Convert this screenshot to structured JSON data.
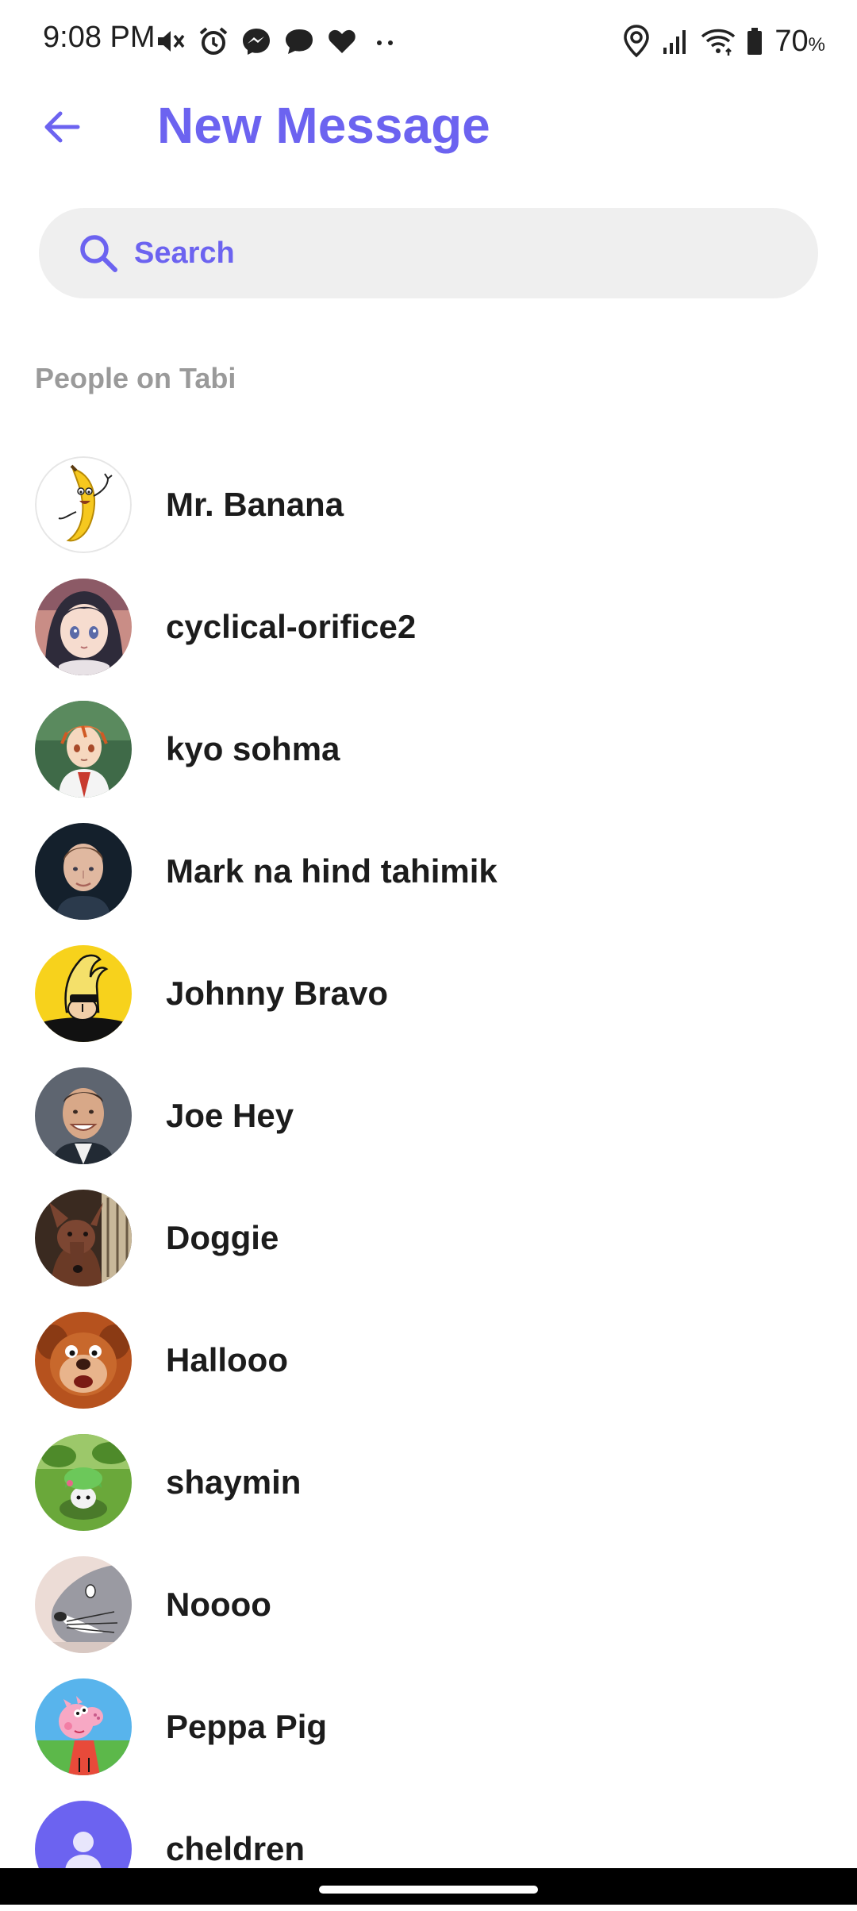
{
  "status_bar": {
    "time": "9:08 PM",
    "battery": "70",
    "battery_unit": "%",
    "icons_left": [
      "mute-icon",
      "alarm-icon",
      "messenger-icon",
      "chat-bubble-icon",
      "heart-icon",
      "more-dots-icon"
    ],
    "icons_right": [
      "location-icon",
      "signal-icon",
      "wifi-icon",
      "battery-icon"
    ]
  },
  "header": {
    "title": "New Message",
    "accent_color": "#6c63f0"
  },
  "search": {
    "placeholder": "Search"
  },
  "section": {
    "label": "People on Tabi"
  },
  "contacts": [
    {
      "name": "Mr. Banana",
      "avatar": "banana-avatar"
    },
    {
      "name": "cyclical-orifice2",
      "avatar": "anime-girl-avatar"
    },
    {
      "name": "kyo sohma",
      "avatar": "anime-boy-avatar"
    },
    {
      "name": "Mark na hind tahimik",
      "avatar": "man-portrait-avatar"
    },
    {
      "name": "Johnny Bravo",
      "avatar": "cartoon-character-avatar"
    },
    {
      "name": "Joe Hey",
      "avatar": "smiling-man-avatar"
    },
    {
      "name": "Doggie",
      "avatar": "dog-avatar"
    },
    {
      "name": "Hallooo",
      "avatar": "cartoon-mouse-avatar"
    },
    {
      "name": "shaymin",
      "avatar": "pokemon-avatar"
    },
    {
      "name": "Noooo",
      "avatar": "cartoon-rabbit-avatar"
    },
    {
      "name": "Peppa Pig",
      "avatar": "cartoon-pig-avatar"
    },
    {
      "name": "cheldren",
      "avatar": "default-person-avatar"
    }
  ]
}
